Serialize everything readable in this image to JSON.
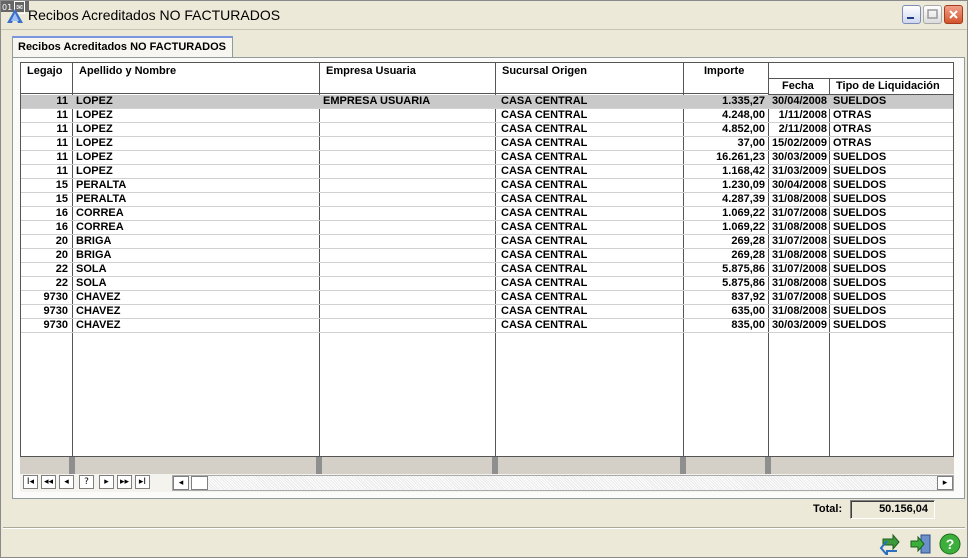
{
  "window": {
    "badge": "01",
    "title": "Recibos Acreditados NO FACTURADOS"
  },
  "tab": {
    "label": "Recibos Acreditados NO FACTURADOS"
  },
  "grid": {
    "columns": {
      "legajo": "Legajo",
      "nombre": "Apellido y Nombre",
      "empresa": "Empresa Usuaria",
      "sucursal": "Sucursal Origen",
      "importe": "Importe",
      "fecha": "Fecha",
      "tipo": "Tipo de Liquidación"
    },
    "rows": [
      {
        "legajo": "11",
        "nombre": "LOPEZ",
        "empresa": "EMPRESA USUARIA",
        "sucursal": "CASA CENTRAL",
        "importe": "1.335,27",
        "fecha": "30/04/2008",
        "tipo": "SUELDOS"
      },
      {
        "legajo": "11",
        "nombre": "LOPEZ",
        "empresa": "",
        "sucursal": "CASA CENTRAL",
        "importe": "4.248,00",
        "fecha": "1/11/2008",
        "tipo": "OTRAS"
      },
      {
        "legajo": "11",
        "nombre": "LOPEZ",
        "empresa": "",
        "sucursal": "CASA CENTRAL",
        "importe": "4.852,00",
        "fecha": "2/11/2008",
        "tipo": "OTRAS"
      },
      {
        "legajo": "11",
        "nombre": "LOPEZ",
        "empresa": "",
        "sucursal": "CASA CENTRAL",
        "importe": "37,00",
        "fecha": "15/02/2009",
        "tipo": "OTRAS"
      },
      {
        "legajo": "11",
        "nombre": "LOPEZ",
        "empresa": "",
        "sucursal": "CASA CENTRAL",
        "importe": "16.261,23",
        "fecha": "30/03/2009",
        "tipo": "SUELDOS"
      },
      {
        "legajo": "11",
        "nombre": "LOPEZ",
        "empresa": "",
        "sucursal": "CASA CENTRAL",
        "importe": "1.168,42",
        "fecha": "31/03/2009",
        "tipo": "SUELDOS"
      },
      {
        "legajo": "15",
        "nombre": "PERALTA",
        "empresa": "",
        "sucursal": "CASA CENTRAL",
        "importe": "1.230,09",
        "fecha": "30/04/2008",
        "tipo": "SUELDOS"
      },
      {
        "legajo": "15",
        "nombre": "PERALTA",
        "empresa": "",
        "sucursal": "CASA CENTRAL",
        "importe": "4.287,39",
        "fecha": "31/08/2008",
        "tipo": "SUELDOS"
      },
      {
        "legajo": "16",
        "nombre": "CORREA",
        "empresa": "",
        "sucursal": "CASA CENTRAL",
        "importe": "1.069,22",
        "fecha": "31/07/2008",
        "tipo": "SUELDOS"
      },
      {
        "legajo": "16",
        "nombre": "CORREA",
        "empresa": "",
        "sucursal": "CASA CENTRAL",
        "importe": "1.069,22",
        "fecha": "31/08/2008",
        "tipo": "SUELDOS"
      },
      {
        "legajo": "20",
        "nombre": "BRIGA",
        "empresa": "",
        "sucursal": "CASA CENTRAL",
        "importe": "269,28",
        "fecha": "31/07/2008",
        "tipo": "SUELDOS"
      },
      {
        "legajo": "20",
        "nombre": "BRIGA",
        "empresa": "",
        "sucursal": "CASA CENTRAL",
        "importe": "269,28",
        "fecha": "31/08/2008",
        "tipo": "SUELDOS"
      },
      {
        "legajo": "22",
        "nombre": "SOLA",
        "empresa": "",
        "sucursal": "CASA CENTRAL",
        "importe": "5.875,86",
        "fecha": "31/07/2008",
        "tipo": "SUELDOS"
      },
      {
        "legajo": "22",
        "nombre": "SOLA",
        "empresa": "",
        "sucursal": "CASA CENTRAL",
        "importe": "5.875,86",
        "fecha": "31/08/2008",
        "tipo": "SUELDOS"
      },
      {
        "legajo": "9730",
        "nombre": "CHAVEZ",
        "empresa": "",
        "sucursal": "CASA CENTRAL",
        "importe": "837,92",
        "fecha": "31/07/2008",
        "tipo": "SUELDOS"
      },
      {
        "legajo": "9730",
        "nombre": "CHAVEZ",
        "empresa": "",
        "sucursal": "CASA CENTRAL",
        "importe": "635,00",
        "fecha": "31/08/2008",
        "tipo": "SUELDOS"
      },
      {
        "legajo": "9730",
        "nombre": "CHAVEZ",
        "empresa": "",
        "sucursal": "CASA CENTRAL",
        "importe": "835,00",
        "fecha": "30/03/2009",
        "tipo": "SUELDOS"
      }
    ]
  },
  "navigator": {
    "first": "I◂",
    "prev_page": "◂◂",
    "prev": "◂",
    "help": "?",
    "next": "▸",
    "next_page": "▸▸",
    "last": "▸I"
  },
  "footer": {
    "total_label": "Total:",
    "total_value": "50.156,04"
  },
  "colors": {
    "window_bg": "#ece9d8",
    "selected_row": "#c9c9c9",
    "tab_accent": "#7a96df"
  }
}
